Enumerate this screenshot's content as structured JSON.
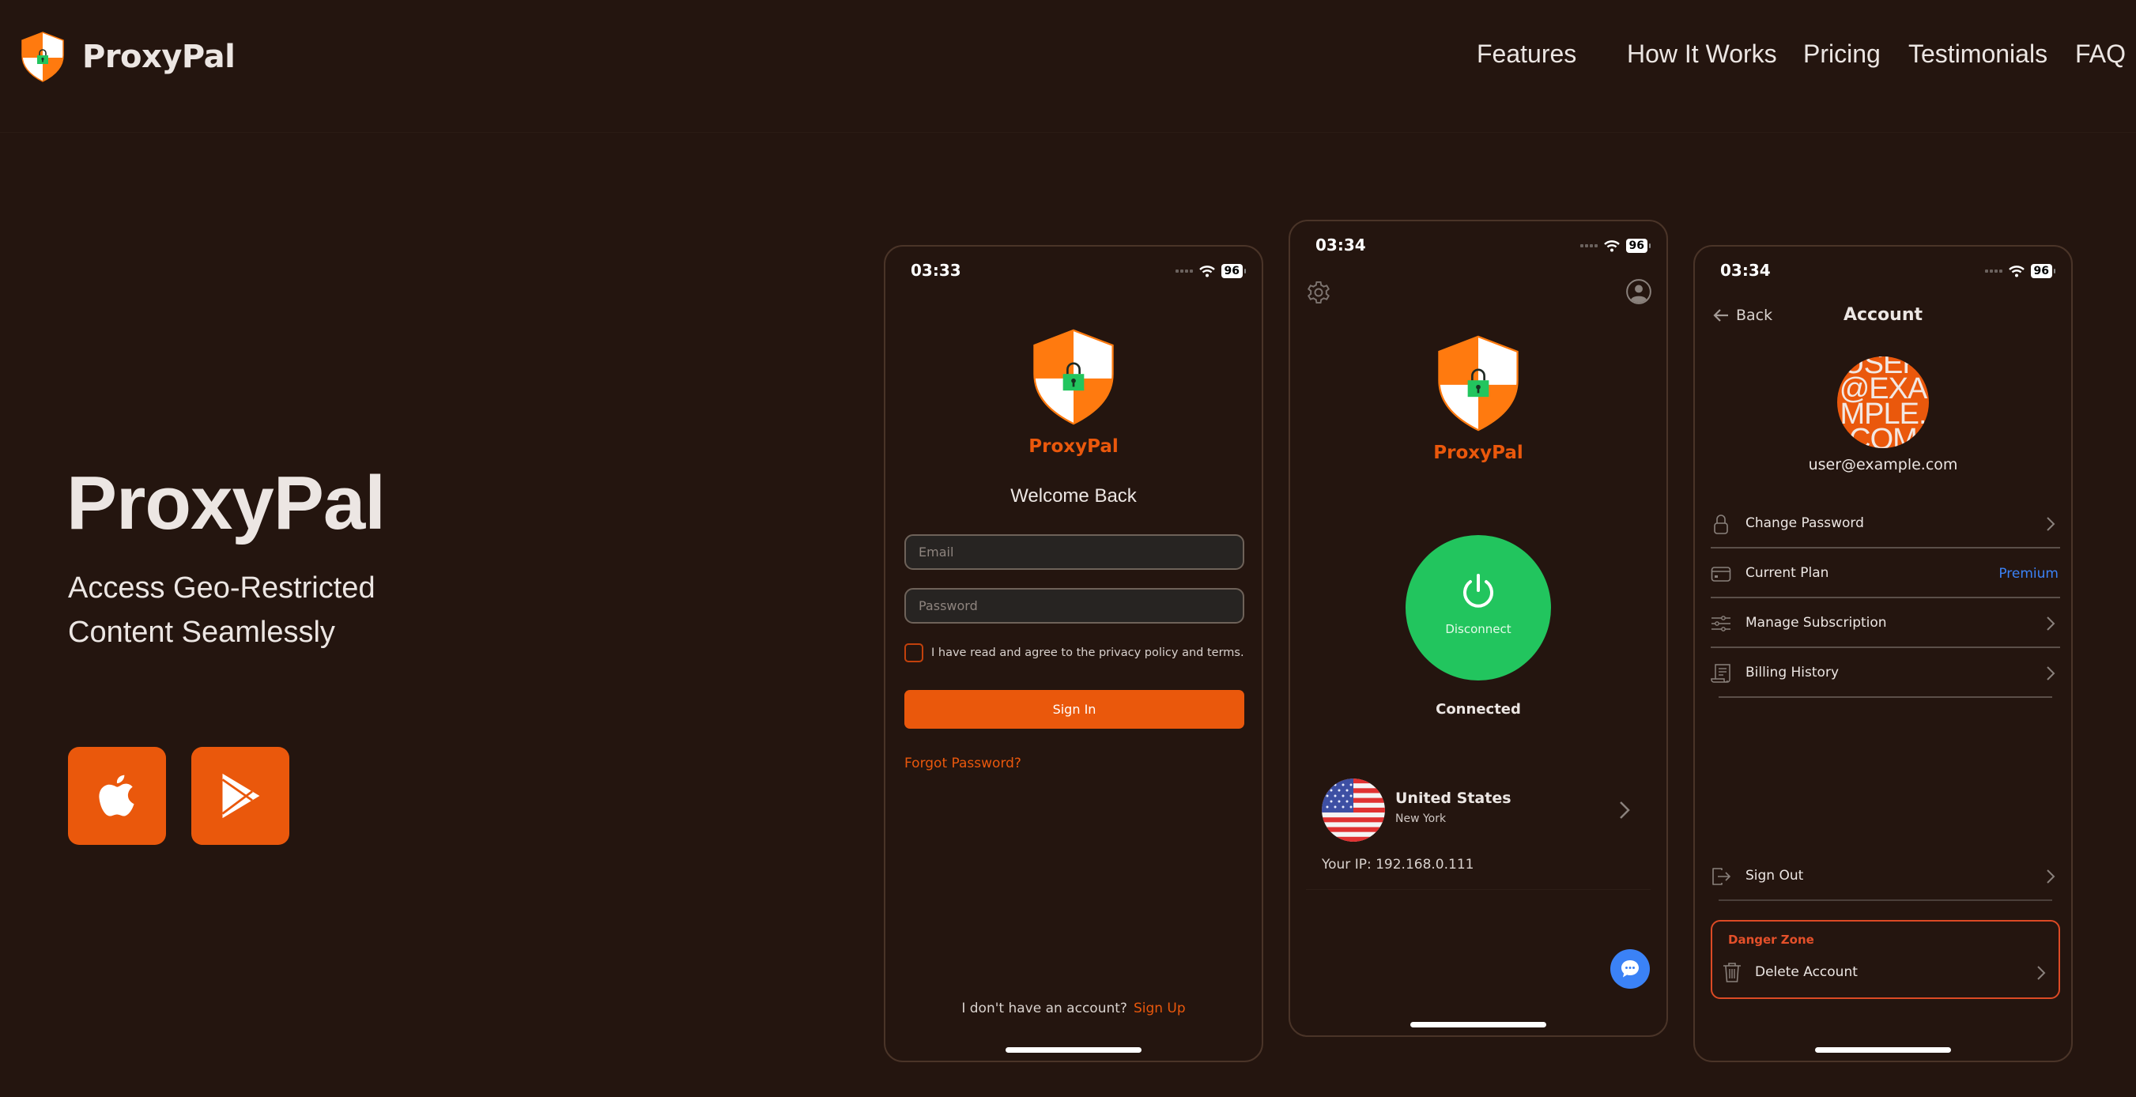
{
  "header": {
    "brand": "ProxyPal",
    "nav": [
      {
        "label": "Features"
      },
      {
        "label": "How It Works"
      },
      {
        "label": "Pricing"
      },
      {
        "label": "Testimonials"
      },
      {
        "label": "FAQ"
      }
    ]
  },
  "hero": {
    "title": "ProxyPal",
    "subtitle": "Access Geo-Restricted Content Seamlessly",
    "store_buttons": [
      {
        "icon": "apple-icon",
        "label": "App Store"
      },
      {
        "icon": "play-store-icon",
        "label": "Google Play"
      }
    ]
  },
  "colors": {
    "background": "#24150f",
    "accent": "#ea580c",
    "connected": "#22c55e",
    "link_blue": "#3b82f6",
    "danger": "#dc4a25"
  },
  "status_bar": {
    "battery": "96"
  },
  "login_screen": {
    "time": "03:33",
    "app_name": "ProxyPal",
    "welcome": "Welcome Back",
    "email_placeholder": "Email",
    "email_value": "",
    "password_placeholder": "Password",
    "password_value": "",
    "agree_label": "I have read and agree to the privacy policy and terms.",
    "agree_checked": false,
    "signin_label": "Sign In",
    "forgot_label": "Forgot Password?",
    "no_account_label": "I don't have an account?",
    "signup_label": "Sign Up"
  },
  "home_screen": {
    "time": "03:34",
    "app_name": "ProxyPal",
    "power_label": "Disconnect",
    "status": "Connected",
    "location": {
      "country": "United States",
      "city": "New York",
      "flag": "us-flag"
    },
    "ip_label": "Your IP: 192.168.0.111"
  },
  "account_screen": {
    "time": "03:34",
    "back_label": "Back",
    "title": "Account",
    "avatar_text": "USER@EXAMPLE.COM",
    "email": "user@example.com",
    "menu": [
      {
        "label": "Change Password",
        "icon": "lock-icon"
      },
      {
        "label": "Current Plan",
        "icon": "credit-card-icon",
        "value": "Premium"
      },
      {
        "label": "Manage Subscription",
        "icon": "sliders-icon"
      },
      {
        "label": "Billing History",
        "icon": "receipt-icon"
      }
    ],
    "sign_out_label": "Sign Out",
    "danger_zone": {
      "title": "Danger Zone",
      "delete_label": "Delete Account"
    }
  }
}
